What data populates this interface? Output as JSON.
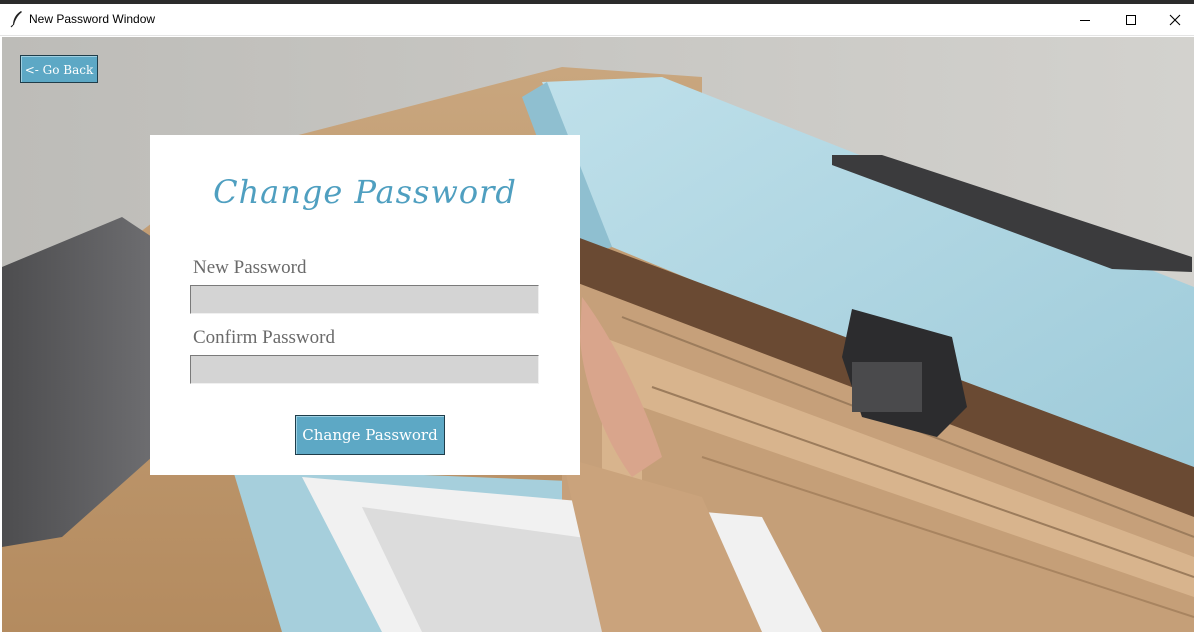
{
  "window": {
    "title": "New Password Window",
    "controls": [
      "minimize",
      "maximize",
      "close"
    ]
  },
  "nav": {
    "go_back_label": "<- Go Back"
  },
  "form": {
    "heading": "Change Password",
    "new_password_label": "New Password",
    "new_password_value": "",
    "confirm_password_label": "Confirm Password",
    "confirm_password_value": "",
    "submit_label": "Change Password"
  },
  "colors": {
    "accent": "#5da8c5",
    "heading": "#4f9fc0",
    "input_bg": "#d4d4d4",
    "panel_bg": "#ffffff"
  },
  "icons": {
    "app": "feather-icon",
    "minimize": "minimize-icon",
    "maximize": "maximize-icon",
    "close": "close-icon"
  }
}
